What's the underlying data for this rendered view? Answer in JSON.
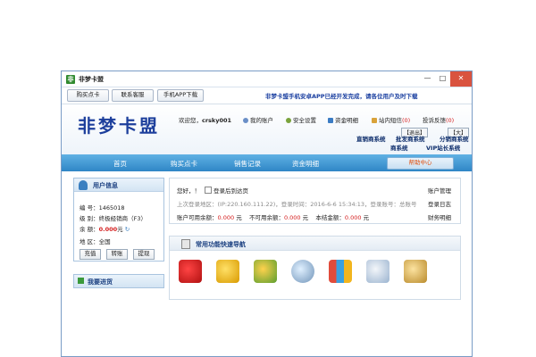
{
  "window": {
    "title": "非梦卡盟"
  },
  "controls": {
    "minimize": "—",
    "maximize": "□",
    "close": "✕"
  },
  "toolbar": {
    "buy_card": "购买点卡",
    "contact": "联系客服",
    "mobile_app": "手机APP下载"
  },
  "marquee": "非梦卡盟手机安卓APP已经开发完成，请各位用户及时下载",
  "header": {
    "logo": "非梦卡盟",
    "welcome_label": "欢迎您，",
    "username": "crsky001",
    "links": {
      "account": "我的账户",
      "security": "安全设置",
      "funds": "资金明细",
      "messages": "站内短信",
      "messages_count": "(0)",
      "complaints": "投诉反馈",
      "complaints_count": "(0)"
    },
    "quick": {
      "direct": "直销商系统",
      "wholesale": "批发商系统",
      "distributor": "分销商系统",
      "vip": "VIP站长系统",
      "merchant": "商系统"
    },
    "mini_buttons": [
      "【退出】",
      "【大】"
    ]
  },
  "nav": {
    "items": [
      "首页",
      "购买点卡",
      "销售记录",
      "资金明细"
    ],
    "help": "帮助中心"
  },
  "user_info": {
    "title": "用户信息",
    "id_label": "编 号：",
    "id": "1465018",
    "level_label": "级 别：",
    "level": "终极经销商（F3）",
    "balance_label": "余 额：",
    "balance": "0.000",
    "balance_unit": "元",
    "region_label": "地 区：",
    "region": "全国",
    "buttons": [
      "充值",
      "转账",
      "提现"
    ]
  },
  "stock": {
    "title": "我要进货"
  },
  "account": {
    "greeting": "您好，！",
    "remember_label": "登录后到达页",
    "last_login": "上次登录地区：(IP:220.160.111.22)，登录时间：2016-6-6 15:34:13，登录账号：总账号",
    "available_label": "账户可用余额：",
    "available": "0.000",
    "unavailable_label": "不可用余额：",
    "unavailable": "0.000",
    "settlement_label": "本结金额：",
    "settlement": "0.000",
    "unit": "元",
    "links": [
      "账户管理",
      "登录日志",
      "财务明细"
    ]
  },
  "quick_nav": {
    "title": "常用功能快速导航",
    "icons": [
      "shopping-cart-icon",
      "star-icon",
      "coins-add-icon",
      "magnifier-icon",
      "bar-chart-icon",
      "document-icon",
      "lock-icon"
    ]
  },
  "colors": {
    "accent": "#2f86c6",
    "logo": "#1d3f9c",
    "money": "#d41c1c"
  }
}
